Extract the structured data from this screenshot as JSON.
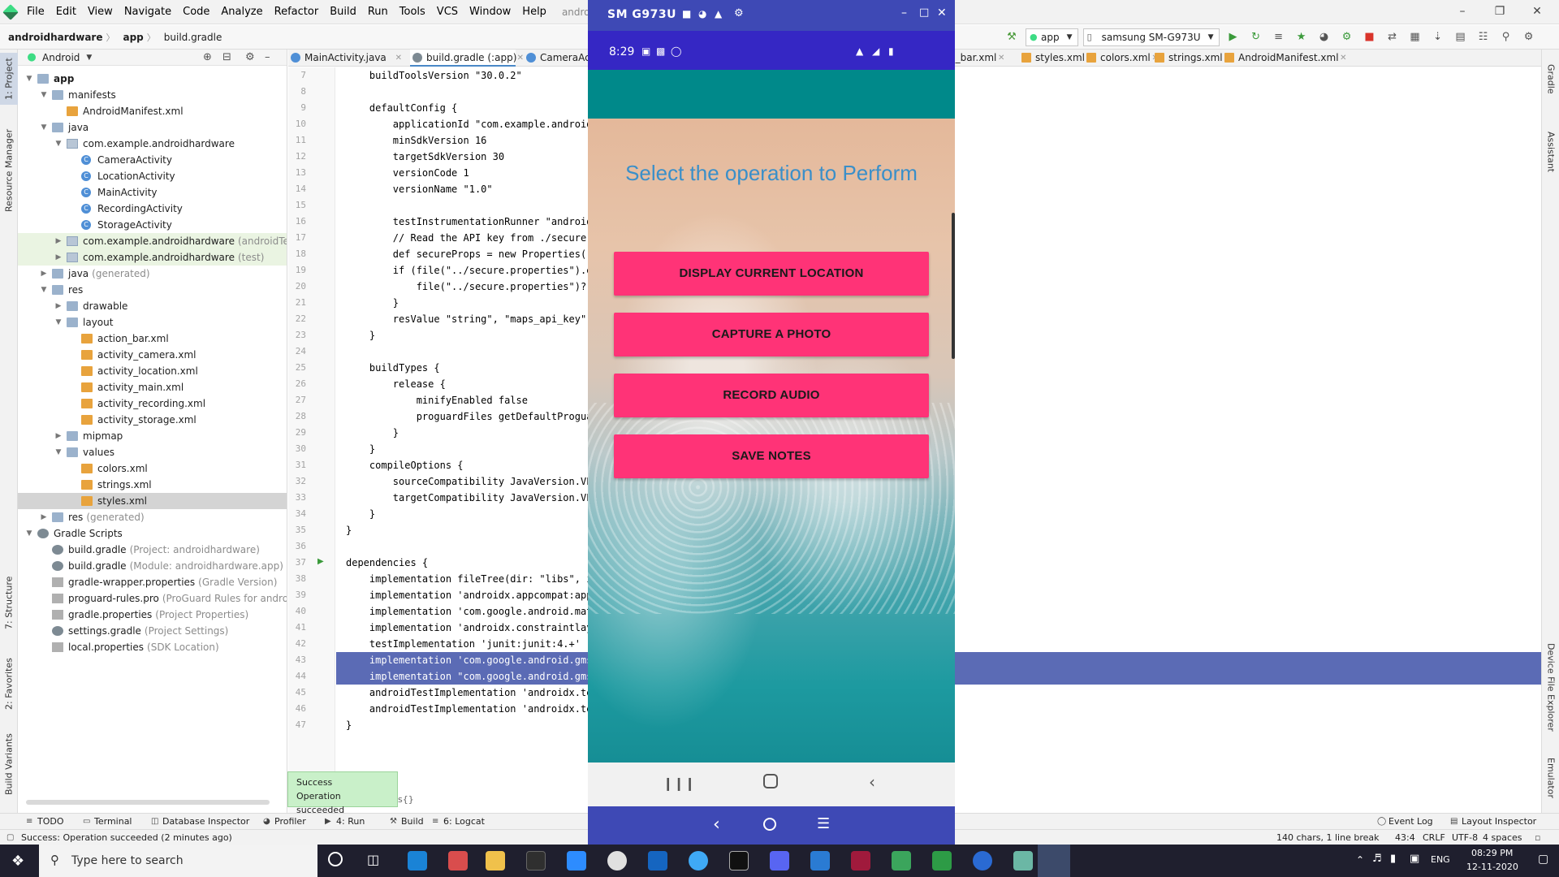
{
  "menubar": {
    "items": [
      "File",
      "Edit",
      "View",
      "Navigate",
      "Code",
      "Analyze",
      "Refactor",
      "Build",
      "Run",
      "Tools",
      "VCS",
      "Window",
      "Help"
    ],
    "title": "androidhardware - buil"
  },
  "navbar": {
    "crumbs": [
      "androidhardware",
      "app",
      "build.gradle"
    ],
    "run_config": "app",
    "device": "samsung SM-G973U"
  },
  "left_tabs": [
    "1: Project",
    "Resource Manager",
    "7: Structure",
    "2: Favorites",
    "Build Variants"
  ],
  "right_tabs": [
    "Gradle",
    "Assistant",
    "Device File Explorer",
    "Emulator"
  ],
  "project": {
    "view_label": "Android",
    "tree": [
      {
        "label": "app",
        "note": "",
        "depth": 0,
        "icon": "folder",
        "arrow": "down",
        "bold": true
      },
      {
        "label": "manifests",
        "note": "",
        "depth": 1,
        "icon": "folder",
        "arrow": "down"
      },
      {
        "label": "AndroidManifest.xml",
        "note": "",
        "depth": 2,
        "icon": "xml",
        "arrow": ""
      },
      {
        "label": "java",
        "note": "",
        "depth": 1,
        "icon": "folder",
        "arrow": "down"
      },
      {
        "label": "com.example.androidhardware",
        "note": "",
        "depth": 2,
        "icon": "pkg",
        "arrow": "down"
      },
      {
        "label": "CameraActivity",
        "note": "",
        "depth": 3,
        "icon": "cls",
        "arrow": ""
      },
      {
        "label": "LocationActivity",
        "note": "",
        "depth": 3,
        "icon": "cls",
        "arrow": ""
      },
      {
        "label": "MainActivity",
        "note": "",
        "depth": 3,
        "icon": "cls",
        "arrow": ""
      },
      {
        "label": "RecordingActivity",
        "note": "",
        "depth": 3,
        "icon": "cls",
        "arrow": ""
      },
      {
        "label": "StorageActivity",
        "note": "",
        "depth": 3,
        "icon": "cls",
        "arrow": ""
      },
      {
        "label": "com.example.androidhardware",
        "note": "(androidTest)",
        "depth": 2,
        "icon": "pkg",
        "arrow": "right",
        "tint": "green"
      },
      {
        "label": "com.example.androidhardware",
        "note": "(test)",
        "depth": 2,
        "icon": "pkg",
        "arrow": "right",
        "tint": "green"
      },
      {
        "label": "java",
        "note": "(generated)",
        "depth": 1,
        "icon": "folder",
        "arrow": "right"
      },
      {
        "label": "res",
        "note": "",
        "depth": 1,
        "icon": "folder",
        "arrow": "down"
      },
      {
        "label": "drawable",
        "note": "",
        "depth": 2,
        "icon": "folder",
        "arrow": "right"
      },
      {
        "label": "layout",
        "note": "",
        "depth": 2,
        "icon": "folder",
        "arrow": "down"
      },
      {
        "label": "action_bar.xml",
        "note": "",
        "depth": 3,
        "icon": "xml",
        "arrow": ""
      },
      {
        "label": "activity_camera.xml",
        "note": "",
        "depth": 3,
        "icon": "xml",
        "arrow": ""
      },
      {
        "label": "activity_location.xml",
        "note": "",
        "depth": 3,
        "icon": "xml",
        "arrow": ""
      },
      {
        "label": "activity_main.xml",
        "note": "",
        "depth": 3,
        "icon": "xml",
        "arrow": ""
      },
      {
        "label": "activity_recording.xml",
        "note": "",
        "depth": 3,
        "icon": "xml",
        "arrow": ""
      },
      {
        "label": "activity_storage.xml",
        "note": "",
        "depth": 3,
        "icon": "xml",
        "arrow": ""
      },
      {
        "label": "mipmap",
        "note": "",
        "depth": 2,
        "icon": "folder",
        "arrow": "right"
      },
      {
        "label": "values",
        "note": "",
        "depth": 2,
        "icon": "folder",
        "arrow": "down"
      },
      {
        "label": "colors.xml",
        "note": "",
        "depth": 3,
        "icon": "xml",
        "arrow": ""
      },
      {
        "label": "strings.xml",
        "note": "",
        "depth": 3,
        "icon": "xml",
        "arrow": ""
      },
      {
        "label": "styles.xml",
        "note": "",
        "depth": 3,
        "icon": "xml",
        "arrow": "",
        "selected": true
      },
      {
        "label": "res",
        "note": "(generated)",
        "depth": 1,
        "icon": "folder",
        "arrow": "right"
      },
      {
        "label": "Gradle Scripts",
        "note": "",
        "depth": 0,
        "icon": "gradle",
        "arrow": "down"
      },
      {
        "label": "build.gradle",
        "note": "(Project: androidhardware)",
        "depth": 1,
        "icon": "gradle",
        "arrow": ""
      },
      {
        "label": "build.gradle",
        "note": "(Module: androidhardware.app)",
        "depth": 1,
        "icon": "gradle",
        "arrow": ""
      },
      {
        "label": "gradle-wrapper.properties",
        "note": "(Gradle Version)",
        "depth": 1,
        "icon": "props",
        "arrow": ""
      },
      {
        "label": "proguard-rules.pro",
        "note": "(ProGuard Rules for androidhardw",
        "depth": 1,
        "icon": "props",
        "arrow": ""
      },
      {
        "label": "gradle.properties",
        "note": "(Project Properties)",
        "depth": 1,
        "icon": "props",
        "arrow": ""
      },
      {
        "label": "settings.gradle",
        "note": "(Project Settings)",
        "depth": 1,
        "icon": "gradle",
        "arrow": ""
      },
      {
        "label": "local.properties",
        "note": "(SDK Location)",
        "depth": 1,
        "icon": "props",
        "arrow": ""
      }
    ]
  },
  "editor_tabs_left": [
    {
      "label": "MainActivity.java",
      "color": "#4f8fd6"
    },
    {
      "label": "build.gradle (:app)",
      "color": "#7d8a93",
      "active": true
    },
    {
      "label": "CameraAc",
      "color": "#4f8fd6"
    }
  ],
  "editor_tabs_right": [
    {
      "label": "n_bar.xml"
    },
    {
      "label": "styles.xml"
    },
    {
      "label": "colors.xml"
    },
    {
      "label": "strings.xml"
    },
    {
      "label": "AndroidManifest.xml"
    }
  ],
  "code": {
    "lines": [
      {
        "n": "7",
        "t": "    buildToolsVersion \"30.0.2\""
      },
      {
        "n": "8",
        "t": ""
      },
      {
        "n": "9",
        "t": "    defaultConfig {"
      },
      {
        "n": "10",
        "t": "        applicationId \"com.example.androidha"
      },
      {
        "n": "11",
        "t": "        minSdkVersion 16"
      },
      {
        "n": "12",
        "t": "        targetSdkVersion 30"
      },
      {
        "n": "13",
        "t": "        versionCode 1"
      },
      {
        "n": "14",
        "t": "        versionName \"1.0\""
      },
      {
        "n": "15",
        "t": ""
      },
      {
        "n": "16",
        "t": "        testInstrumentationRunner \"androidx."
      },
      {
        "n": "17",
        "t": "        // Read the API key from ./secure.pr"
      },
      {
        "n": "18",
        "t": "        def secureProps = new Properties()"
      },
      {
        "n": "19",
        "t": "        if (file(\"../secure.properties\").exi"
      },
      {
        "n": "20",
        "t": "            file(\"../secure.properties\")?.wi"
      },
      {
        "n": "21",
        "t": "        }"
      },
      {
        "n": "22",
        "t": "        resValue \"string\", \"maps_api_key\", ("
      },
      {
        "n": "23",
        "t": "    }"
      },
      {
        "n": "24",
        "t": ""
      },
      {
        "n": "25",
        "t": "    buildTypes {"
      },
      {
        "n": "26",
        "t": "        release {"
      },
      {
        "n": "27",
        "t": "            minifyEnabled false"
      },
      {
        "n": "28",
        "t": "            proguardFiles getDefaultProguard"
      },
      {
        "n": "29",
        "t": "        }"
      },
      {
        "n": "30",
        "t": "    }"
      },
      {
        "n": "31",
        "t": "    compileOptions {"
      },
      {
        "n": "32",
        "t": "        sourceCompatibility JavaVersion.VERS"
      },
      {
        "n": "33",
        "t": "        targetCompatibility JavaVersion.VERS"
      },
      {
        "n": "34",
        "t": "    }"
      },
      {
        "n": "35",
        "t": "}"
      },
      {
        "n": "36",
        "t": ""
      },
      {
        "n": "37",
        "t": "dependencies {"
      },
      {
        "n": "38",
        "t": "    implementation fileTree(dir: \"libs\", inc"
      },
      {
        "n": "39",
        "t": "    implementation 'androidx.appcompat:appco"
      },
      {
        "n": "40",
        "t": "    implementation 'com.google.android.mater"
      },
      {
        "n": "41",
        "t": "    implementation 'androidx.constraintlayou"
      },
      {
        "n": "42",
        "t": "    testImplementation 'junit:junit:4.+'"
      },
      {
        "n": "43",
        "t": "    implementation 'com.google.android.gms:p",
        "hl": true
      },
      {
        "n": "44",
        "t": "    implementation \"com.google.android.gms:p",
        "hl": true
      },
      {
        "n": "45",
        "t": "    androidTestImplementation 'androidx.test"
      },
      {
        "n": "46",
        "t": "    androidTestImplementation 'androidx.test"
      },
      {
        "n": "47",
        "t": "}"
      }
    ]
  },
  "toast": {
    "title": "Success",
    "message": "Operation succeeded"
  },
  "toast_tail": "s{}",
  "bottom_tools": [
    "TODO",
    "Terminal",
    "Database Inspector",
    "Profiler",
    "4: Run",
    "Build",
    "6: Logcat",
    "Event Log",
    "Layout Inspector"
  ],
  "status": {
    "message": "Success: Operation succeeded (2 minutes ago)",
    "chars": "140 chars, 1 line break",
    "position": "43:4",
    "line_sep": "CRLF",
    "encoding": "UTF-8",
    "indent": "4 spaces"
  },
  "emulator": {
    "title": "SM G973U",
    "time": "8:29",
    "screen_title": "Select the operation to Perform",
    "buttons": [
      "DISPLAY CURRENT LOCATION",
      "CAPTURE A PHOTO",
      "RECORD AUDIO",
      "SAVE NOTES"
    ],
    "button_color": "#ff3377"
  },
  "taskbar": {
    "search_placeholder": "Type here to search",
    "lang": "ENG",
    "time": "08:29 PM",
    "date": "12-11-2020"
  }
}
